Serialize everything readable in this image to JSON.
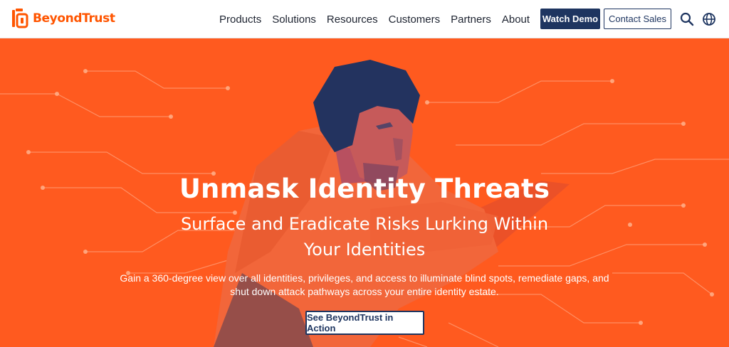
{
  "brand": {
    "name": "BeyondTrust",
    "color": "#ff5500"
  },
  "nav": {
    "items": [
      "Products",
      "Solutions",
      "Resources",
      "Customers",
      "Partners",
      "About"
    ],
    "watch_demo": "Watch Demo",
    "contact_sales": "Contact Sales",
    "icons": [
      "search-icon",
      "globe-icon"
    ]
  },
  "hero": {
    "title": "Unmask Identity Threats",
    "subtitle": "Surface and Eradicate Risks Lurking Within Your Identities",
    "description": "Gain a 360-degree view over all identities, privileges, and access to illuminate blind spots, remediate gaps, and shut down attack pathways across your entire identity estate.",
    "cta": "See BeyondTrust in Action",
    "colors": {
      "background": "#ff5a1f",
      "accent_navy": "#1e3560",
      "text": "#ffffff"
    }
  }
}
